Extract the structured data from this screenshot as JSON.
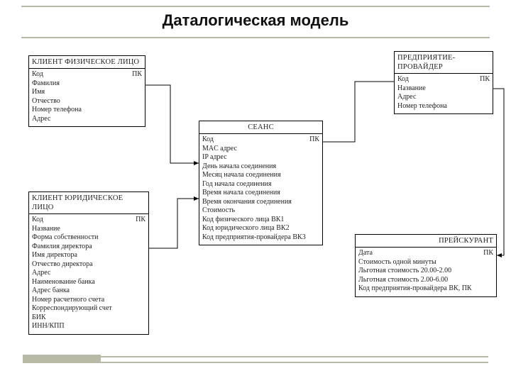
{
  "title": "Даталогическая модель",
  "entities": {
    "client_person": {
      "name": "КЛИЕНТ ФИЗИЧЕСКОЕ ЛИЦО",
      "rows": [
        {
          "field": "Код",
          "key": "ПК"
        },
        {
          "field": "Фамилия",
          "key": ""
        },
        {
          "field": "Имя",
          "key": ""
        },
        {
          "field": "Отчество",
          "key": ""
        },
        {
          "field": "Номер телефона",
          "key": ""
        },
        {
          "field": "Адрес",
          "key": ""
        }
      ]
    },
    "provider": {
      "name": "ПРЕДПРИЯТИЕ-ПРОВАЙДЕР",
      "rows": [
        {
          "field": "Код",
          "key": "ПК"
        },
        {
          "field": "Название",
          "key": ""
        },
        {
          "field": "Адрес",
          "key": ""
        },
        {
          "field": "Номер телефона",
          "key": ""
        }
      ]
    },
    "session": {
      "name": "СЕАНС",
      "rows": [
        {
          "field": "Код",
          "key": "ПК"
        },
        {
          "field": "MAC адрес",
          "key": ""
        },
        {
          "field": "IP адрес",
          "key": ""
        },
        {
          "field": "День начала соединения",
          "key": ""
        },
        {
          "field": "Месяц начала соединения",
          "key": ""
        },
        {
          "field": "Год начала соединения",
          "key": ""
        },
        {
          "field": "Время начала соединения",
          "key": ""
        },
        {
          "field": "Время окончания соединения",
          "key": ""
        },
        {
          "field": "Стоимость",
          "key": ""
        },
        {
          "field": "Код физического лица ВК1",
          "key": ""
        },
        {
          "field": "Код юридического лица ВК2",
          "key": ""
        },
        {
          "field": "Код предприятия-провайдера ВК3",
          "key": ""
        }
      ]
    },
    "client_legal": {
      "name": "КЛИЕНТ ЮРИДИЧЕСКОЕ ЛИЦО",
      "rows": [
        {
          "field": "Код",
          "key": "ПК"
        },
        {
          "field": "Название",
          "key": ""
        },
        {
          "field": "Форма собственности",
          "key": ""
        },
        {
          "field": "Фамилия директора",
          "key": ""
        },
        {
          "field": "Имя директора",
          "key": ""
        },
        {
          "field": "Отчество директора",
          "key": ""
        },
        {
          "field": "Адрес",
          "key": ""
        },
        {
          "field": "Наименование банка",
          "key": ""
        },
        {
          "field": "Адрес банка",
          "key": ""
        },
        {
          "field": "Номер расчетного счета",
          "key": ""
        },
        {
          "field": "Корреспондирующий счет",
          "key": ""
        },
        {
          "field": "БИК",
          "key": ""
        },
        {
          "field": "ИНН/КПП",
          "key": ""
        }
      ]
    },
    "pricelist": {
      "name": "ПРЕЙСКУРАНТ",
      "rows": [
        {
          "field": "Дата",
          "key": "ПК"
        },
        {
          "field": "Стоимость одной минуты",
          "key": ""
        },
        {
          "field": "Льготная стоимость 20.00-2.00",
          "key": ""
        },
        {
          "field": "Льготная стоимость 2.00-6.00",
          "key": ""
        },
        {
          "field": "Код предприятия-провайдера ВК, ПК",
          "key": ""
        }
      ]
    }
  }
}
